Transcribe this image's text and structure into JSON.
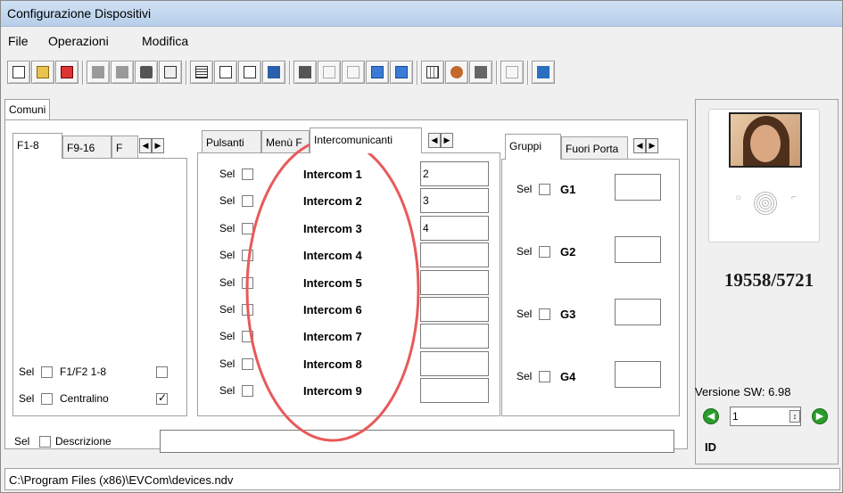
{
  "window": {
    "title": "Configurazione Dispositivi"
  },
  "menu": {
    "items": [
      "File",
      "Operazioni",
      "Modifica"
    ]
  },
  "toolbar": {
    "icons": [
      "new-icon",
      "open-icon",
      "import-icon",
      "save-icon",
      "save-all-icon",
      "print-icon",
      "print-preview-icon",
      "list-icon",
      "export-icon",
      "edit-icon",
      "copy-config-icon",
      "paste-icon",
      "undo-icon",
      "redo-icon",
      "check-icon",
      "alert-icon",
      "table-icon",
      "users-icon",
      "book-icon",
      "tools-icon",
      "exit-icon"
    ]
  },
  "tabs": {
    "main": "Comuni"
  },
  "left_panel": {
    "tabs": [
      "F1-8",
      "F9-16",
      "F"
    ],
    "rows": [
      {
        "sel": "Sel",
        "label": "F1/F2 1-8",
        "checked": false
      },
      {
        "sel": "Sel",
        "label": "Centralino",
        "checked": true
      }
    ]
  },
  "center_panel": {
    "tabs": [
      "Pulsanti",
      "Menù F",
      "Intercomunicanti"
    ],
    "sel_label": "Sel",
    "intercoms": [
      {
        "label": "Intercom 1",
        "value": "2"
      },
      {
        "label": "Intercom 2",
        "value": "3"
      },
      {
        "label": "Intercom 3",
        "value": "4"
      },
      {
        "label": "Intercom 4",
        "value": ""
      },
      {
        "label": "Intercom 5",
        "value": ""
      },
      {
        "label": "Intercom 6",
        "value": ""
      },
      {
        "label": "Intercom 7",
        "value": ""
      },
      {
        "label": "Intercom 8",
        "value": ""
      },
      {
        "label": "Intercom 9",
        "value": ""
      }
    ]
  },
  "right_panel": {
    "tabs": [
      "Gruppi",
      "Fuori Porta"
    ],
    "sel_label": "Sel",
    "groups": [
      "G1",
      "G2",
      "G3",
      "G4"
    ]
  },
  "description": {
    "sel": "Sel",
    "label": "Descrizione",
    "value": ""
  },
  "side": {
    "model": "19558/5721",
    "version": "Versione SW: 6.98",
    "id_value": "1",
    "id_label": "ID"
  },
  "status": {
    "path": "C:\\Program Files (x86)\\EVCom\\devices.ndv"
  },
  "colors": {
    "highlight_ellipse": "#e85a5a",
    "title_bg": "#c4d8ee",
    "nav_green": "#2a9d2a"
  }
}
